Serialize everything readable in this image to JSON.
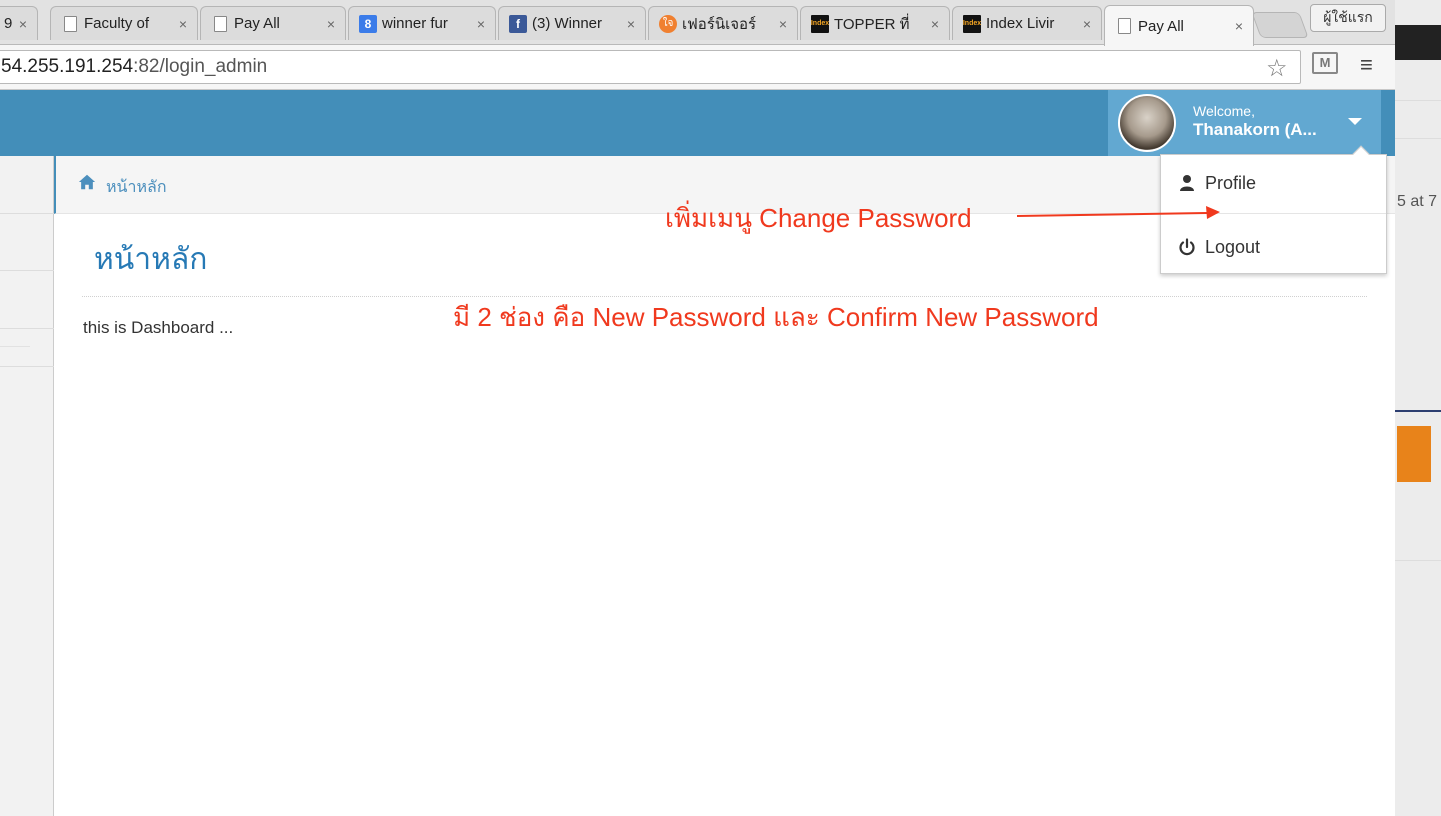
{
  "browser": {
    "tabs": [
      {
        "title": "9",
        "favicon": "page-icon"
      },
      {
        "title": "Faculty of",
        "favicon": "page-icon"
      },
      {
        "title": "Pay All",
        "favicon": "page-icon"
      },
      {
        "title": "winner fur",
        "favicon": "google-icon"
      },
      {
        "title": "(3) Winner",
        "favicon": "facebook-icon"
      },
      {
        "title": "เฟอร์นิเจอร์",
        "favicon": "orange-logo-icon"
      },
      {
        "title": "TOPPER ที่",
        "favicon": "index-icon"
      },
      {
        "title": "Index Livir",
        "favicon": "index-icon"
      },
      {
        "title": "Pay All",
        "favicon": "page-icon",
        "active": true
      }
    ],
    "close_glyph": "×",
    "profile_button": "ผู้ใช้แรก",
    "address": {
      "host": "54.255.191.254",
      "path": ":82/login_admin"
    },
    "favicon_letters": {
      "google": "8",
      "facebook": "f",
      "index": "Index",
      "orange": "ใจ"
    }
  },
  "navbar": {
    "welcome": "Welcome,",
    "username": "Thanakorn  (A..."
  },
  "breadcrumb": {
    "home_label": "หน้าหลัก"
  },
  "main": {
    "title": "หน้าหลัก",
    "body_text": "this is Dashboard ..."
  },
  "user_menu": {
    "items": [
      {
        "label": "Profile",
        "icon": "user-icon"
      },
      {
        "label": "Logout",
        "icon": "power-icon"
      }
    ]
  },
  "annotations": {
    "note1": "เพิ่มเมนู Change Password",
    "note2": "มี 2 ช่อง คือ New Password และ Confirm New Password",
    "color": "#f0391e"
  },
  "background_window": {
    "partial_text": "5 at 7"
  },
  "colors": {
    "navbar": "#438eb9",
    "user_nav": "#62a8d1",
    "title": "#2679b5"
  }
}
